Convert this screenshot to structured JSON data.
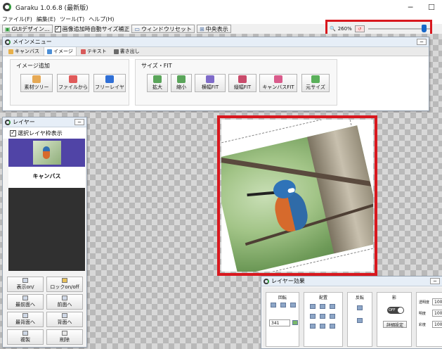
{
  "window": {
    "title": "Garaku 1.0.6.8 (最新版)",
    "minimize": "─",
    "maximize": "☐"
  },
  "menubar": [
    "ファイル(F)",
    "編集(E)",
    "ツール(T)",
    "ヘルプ(H)"
  ],
  "toolbar": {
    "gui_design": "GUIデザイン...",
    "auto_fit_label": "画像追加時自動サイズ補正",
    "auto_fit_checked": true,
    "window_reset": "ウィンドウリセット",
    "center_view": "中央表示",
    "zoom_value": "260%",
    "zoom_fraction": 0.9
  },
  "main_menu": {
    "title": "メインメニュー",
    "min": "─",
    "tabs": [
      "キャンバス",
      "イメージ",
      "テキスト",
      "書き出し"
    ],
    "active_tab": 1,
    "image_add": {
      "label": "イメージ追加",
      "buttons": [
        "素材ツリー",
        "ファイルから",
        "フリーレイヤ"
      ]
    },
    "size_fit": {
      "label": "サイズ・FIT",
      "buttons": [
        "拡大",
        "縮小",
        "横幅FIT",
        "縦幅FIT",
        "キャンバスFIT",
        "元サイズ"
      ]
    }
  },
  "layer_panel": {
    "title": "レイヤー",
    "min": "─",
    "show_frame_label": "選択レイヤ枠表示",
    "show_frame_checked": true,
    "canvas_item": "キャンバス",
    "buttons": [
      "表示on/",
      "ロックon/off",
      "最前面へ",
      "前面へ",
      "最背面へ",
      "背面へ",
      "複製",
      "削除"
    ]
  },
  "layer_effect": {
    "title": "レイヤー効果",
    "min": "─",
    "sections": [
      "回転",
      "配置",
      "反転",
      "影"
    ],
    "rotation_value": "341",
    "toggle": "OFF",
    "detail_button": "詳細設定",
    "right_labels": [
      "透明度",
      "明度",
      "彩度"
    ],
    "right_values": [
      "100",
      "100",
      "100"
    ]
  },
  "colors": {
    "highlight": "#d8181e",
    "slider_thumb": "#1767c9",
    "layer_thumb_bg": "#5044a6"
  }
}
